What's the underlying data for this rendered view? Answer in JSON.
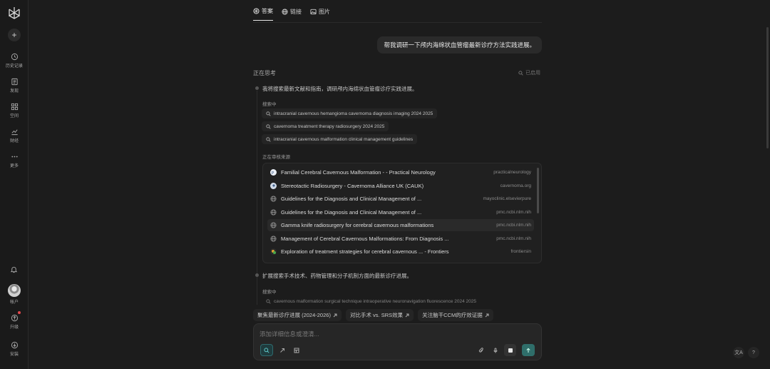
{
  "sidebar": {
    "new_chat": "+",
    "items": [
      {
        "label": "历史记录",
        "icon": "history-icon"
      },
      {
        "label": "发现",
        "icon": "discover-icon"
      },
      {
        "label": "空间",
        "icon": "spaces-icon"
      },
      {
        "label": "财经",
        "icon": "finance-icon"
      },
      {
        "label": "更多",
        "icon": "more-icon"
      }
    ],
    "account_label": "帐户",
    "upgrade_label": "升级",
    "install_label": "安装"
  },
  "tabs": [
    {
      "label": "答案",
      "icon": "answer-icon"
    },
    {
      "label": "链接",
      "icon": "globe-icon"
    },
    {
      "label": "图片",
      "icon": "image-icon"
    }
  ],
  "user_message": "帮我调研一下颅内海绵状血管瘤最新诊疗方法实践进展。",
  "thinking": {
    "header": "正在思考",
    "used_label": "已启用",
    "step1_text": "我将搜索最新文献和指南，调研颅内海绵状血管瘤诊疗实践进展。",
    "searching_label": "搜索中",
    "queries": [
      "intracranial cavernous hemangioma cavernoma diagnosis imaging 2024 2025",
      "cavernoma treatment therapy radiosurgery 2024 2025",
      "intracranial cavernous malformation clinical management guidelines"
    ],
    "reviewing_label": "正在审核来源",
    "sources": [
      {
        "title": "Familial Cerebral Cavernous Malformation - - Practical Neurology",
        "domain": "practicalneurology"
      },
      {
        "title": "Stereotactic Radiosurgery - Cavernoma Alliance UK (CAUK)",
        "domain": "cavernoma.org"
      },
      {
        "title": "Guidelines for the Diagnosis and Clinical Management of ...",
        "domain": "mayoclinic.elsevierpure"
      },
      {
        "title": "Guidelines for the Diagnosis and Clinical Management of ...",
        "domain": "pmc.ncbi.nlm.nih"
      },
      {
        "title": "Gamma knife radiosurgery for cerebral cavernous malformations",
        "domain": "pmc.ncbi.nlm.nih"
      },
      {
        "title": "Management of Cerebral Cavernous Malformations: From Diagnosis ...",
        "domain": "pmc.ncbi.nlm.nih"
      },
      {
        "title": "Exploration of treatment strategies for cerebral cavernous ... - Frontiers",
        "domain": "frontiersin"
      }
    ],
    "step2_text": "扩展搜索手术技术、药物管理和分子机制方面的最新诊疗进展。",
    "searching_label_2": "搜索中",
    "query_4": "cavernous malformation surgical technique intraoperative neuronavigation fluorescence 2024 2025"
  },
  "suggestions": [
    "聚焦最新诊疗进展 (2024-2026)",
    "对比手术 vs. SRS效果",
    "关注脑干CCM的疗效证据"
  ],
  "composer": {
    "placeholder": "添加详细信息或澄清..."
  },
  "corner": {
    "translate": "文A",
    "help": "?"
  }
}
